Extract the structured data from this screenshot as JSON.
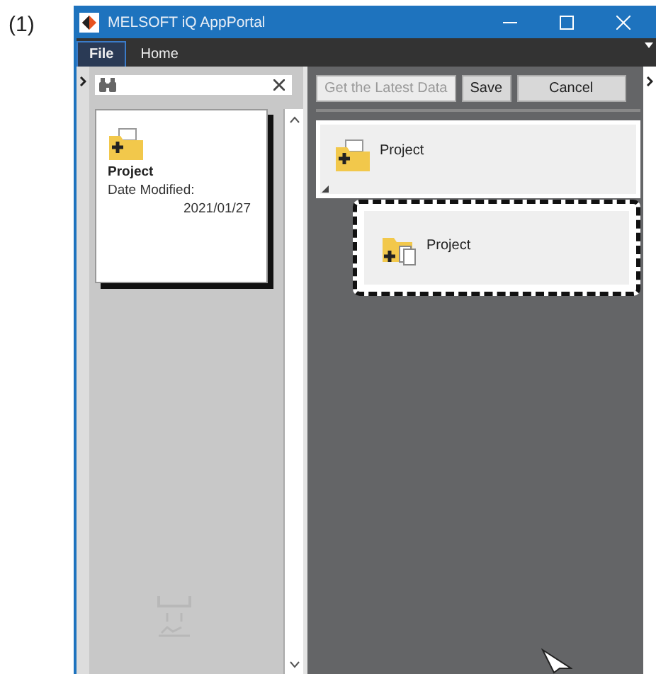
{
  "figure_label": "(1)",
  "window": {
    "title": "MELSOFT iQ AppPortal"
  },
  "menu_tabs": [
    {
      "label": "File",
      "selected": true
    },
    {
      "label": "Home",
      "selected": false
    }
  ],
  "left_panel": {
    "cards": [
      {
        "title": "Project",
        "date_label": "Date Modified:",
        "date": "2021/01/27"
      }
    ]
  },
  "right_panel": {
    "buttons": [
      {
        "label": "Get the Latest Data",
        "disabled": true
      },
      {
        "label": "Save",
        "disabled": false
      },
      {
        "label": "Cancel",
        "disabled": false
      }
    ],
    "tree": {
      "label": "Project",
      "expanded": true,
      "children": [
        {
          "label": "Project",
          "highlighted": true
        }
      ]
    }
  }
}
